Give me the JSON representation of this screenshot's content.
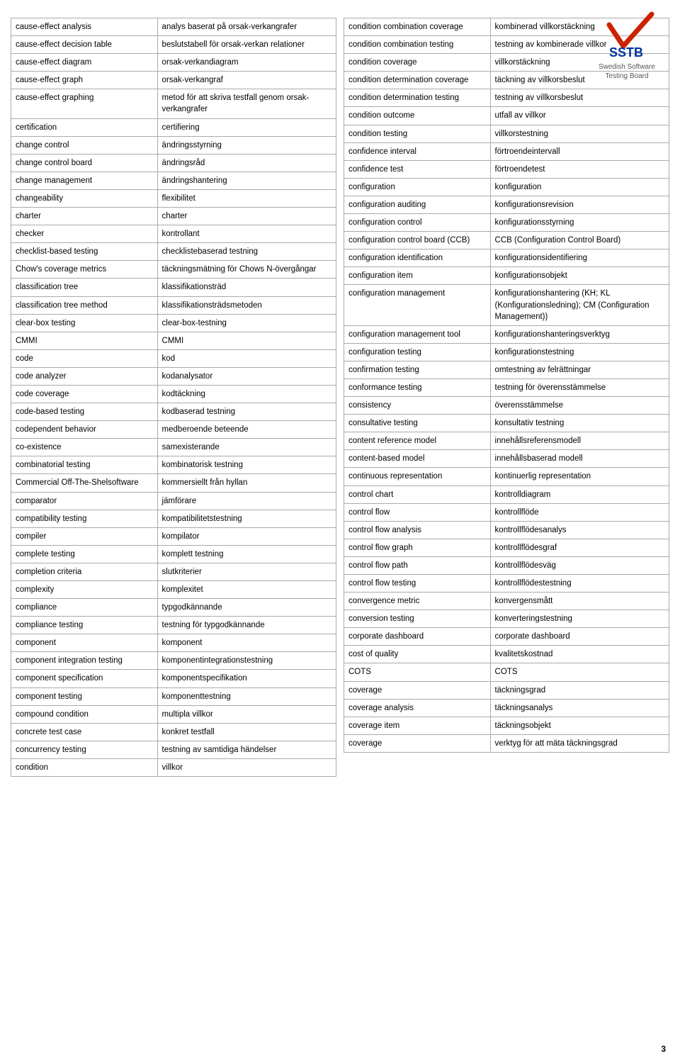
{
  "logo": {
    "brand": "SSTB",
    "subtitle": "Swedish Software\nTesting Board"
  },
  "page_number": "3",
  "left_table": {
    "rows": [
      [
        "cause-effect analysis",
        "analys baserat på orsak-verkangrafer"
      ],
      [
        "cause-effect decision table",
        "beslutstabell för orsak-verkan relationer"
      ],
      [
        "cause-effect diagram",
        "orsak-verkandiagram"
      ],
      [
        "cause-effect graph",
        "orsak-verkangraf"
      ],
      [
        "cause-effect graphing",
        "metod för att skriva testfall genom orsak-verkangrafer"
      ],
      [
        "certification",
        "certifiering"
      ],
      [
        "change control",
        "ändringsstyrning"
      ],
      [
        "change control board",
        "ändringsråd"
      ],
      [
        "change management",
        "ändringshantering"
      ],
      [
        "changeability",
        "flexibilitet"
      ],
      [
        "charter",
        "charter"
      ],
      [
        "checker",
        "kontrollant"
      ],
      [
        "checklist-based testing",
        "checklistebaserad testning"
      ],
      [
        "Chow's coverage metrics",
        "täckningsmätning för Chows N-övergångar"
      ],
      [
        "classification tree",
        "klassifikationsträd"
      ],
      [
        "classification tree method",
        "klassifikationsträdsmetoden"
      ],
      [
        "clear-box testing",
        "clear-box-testning"
      ],
      [
        "CMMI",
        "CMMI"
      ],
      [
        "code",
        "kod"
      ],
      [
        "code analyzer",
        "kodanalysator"
      ],
      [
        "code coverage",
        "kodtäckning"
      ],
      [
        "code-based testing",
        "kodbaserad testning"
      ],
      [
        "codependent behavior",
        "medberoende beteende"
      ],
      [
        "co-existence",
        "samexisterande"
      ],
      [
        "combinatorial testing",
        "kombinatorisk testning"
      ],
      [
        "Commercial Off-The-Shelsoftware",
        "kommersiellt från hyllan"
      ],
      [
        "comparator",
        "jämförare"
      ],
      [
        "compatibility testing",
        "kompatibilitetstestning"
      ],
      [
        "compiler",
        "kompilator"
      ],
      [
        "complete testing",
        "komplett testning"
      ],
      [
        "completion criteria",
        "slutkriterier"
      ],
      [
        "complexity",
        "komplexitet"
      ],
      [
        "compliance",
        "typgodkännande"
      ],
      [
        "compliance testing",
        "testning för typgodkännande"
      ],
      [
        "component",
        "komponent"
      ],
      [
        "component integration testing",
        "komponentintegrationstestning"
      ],
      [
        "component specification",
        "komponentspecifikation"
      ],
      [
        "component testing",
        "komponenttestning"
      ],
      [
        "compound condition",
        "multipla villkor"
      ],
      [
        "concrete test case",
        "konkret testfall"
      ],
      [
        "concurrency testing",
        "testning av samtidiga händelser"
      ],
      [
        "condition",
        "villkor"
      ]
    ]
  },
  "right_table": {
    "rows": [
      [
        "condition combination coverage",
        "kombinerad villkorstäckning"
      ],
      [
        "condition combination testing",
        "testning av kombinerade villkor"
      ],
      [
        "condition coverage",
        "villkorstäckning"
      ],
      [
        "condition determination coverage",
        "täckning av villkorsbeslut"
      ],
      [
        "condition determination testing",
        "testning av villkorsbeslut"
      ],
      [
        "condition outcome",
        "utfall av villkor"
      ],
      [
        "condition testing",
        "villkorstestning"
      ],
      [
        "confidence interval",
        "förtroendeintervall"
      ],
      [
        "confidence test",
        "förtroendetest"
      ],
      [
        "configuration",
        "konfiguration"
      ],
      [
        "configuration auditing",
        "konfigurationsrevision"
      ],
      [
        "configuration control",
        "konfigurationsstyrning"
      ],
      [
        "configuration control board (CCB)",
        "CCB (Configuration Control Board)"
      ],
      [
        "configuration identification",
        "konfigurationsidentifiering"
      ],
      [
        "configuration item",
        "konfigurationsobjekt"
      ],
      [
        "configuration management",
        "konfigurationshantering (KH; KL (Konfigurationsledning); CM (Configuration Management))"
      ],
      [
        "configuration management tool",
        "konfigurationshanteringsverktyg"
      ],
      [
        "configuration testing",
        "konfigurationstestning"
      ],
      [
        "confirmation testing",
        "omtestning av felrättningar"
      ],
      [
        "conformance testing",
        "testning för överensstämmelse"
      ],
      [
        "consistency",
        "överensstämmelse"
      ],
      [
        "consultative testing",
        "konsultativ testning"
      ],
      [
        "content reference model",
        "innehållsreferensmodell"
      ],
      [
        "content-based model",
        "innehållsbaserad modell"
      ],
      [
        "continuous representation",
        "kontinuerlig representation"
      ],
      [
        "control chart",
        "kontrolldiagram"
      ],
      [
        "control flow",
        "kontrollflöde"
      ],
      [
        "control flow analysis",
        "kontrollflödesanalys"
      ],
      [
        "control flow graph",
        "kontrollflödesgraf"
      ],
      [
        "control flow path",
        "kontrollflödesväg"
      ],
      [
        "control flow testing",
        "kontrollflödestestning"
      ],
      [
        "convergence metric",
        "konvergensmått"
      ],
      [
        "conversion testing",
        "konverteringstestning"
      ],
      [
        "corporate dashboard",
        "corporate dashboard"
      ],
      [
        "cost of quality",
        "kvalitetskostnad"
      ],
      [
        "COTS",
        "COTS"
      ],
      [
        "coverage",
        "täckningsgrad"
      ],
      [
        "coverage analysis",
        "täckningsanalys"
      ],
      [
        "coverage item",
        "täckningsobjekt"
      ],
      [
        "coverage",
        "verktyg för att mäta täckningsgrad"
      ]
    ]
  }
}
